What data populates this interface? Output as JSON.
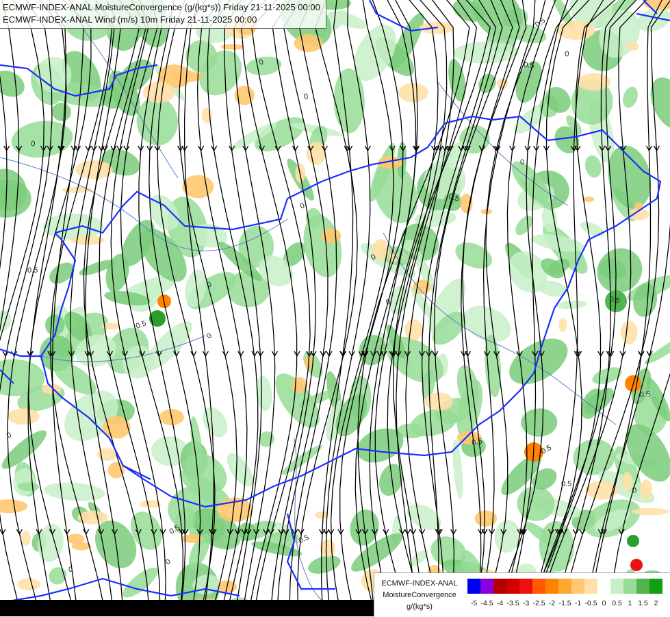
{
  "titles": {
    "line1": "ECMWF-INDEX-ANAL MoistureConvergence (g/(kg*s)) Friday 21-11-2025 00:00",
    "line2": "ECMWF-INDEX-ANAL Wind (m/s) 10m Friday 21-11-2025 00:00"
  },
  "legend": {
    "model": "ECMWF-INDEX-ANAL",
    "field": "MoistureConvergence",
    "unit": "g/(kg*s)",
    "ticks": [
      "-5",
      "-4.5",
      "-4",
      "-3.5",
      "-3",
      "-2.5",
      "-2",
      "-1.5",
      "-1",
      "-0.5",
      "0",
      "0.5",
      "1",
      "1.5",
      "2"
    ],
    "colors": [
      "#0000f0",
      "#8a00e0",
      "#b40000",
      "#d20000",
      "#ee1010",
      "#ff5a00",
      "#ff8200",
      "#ffa830",
      "#ffc870",
      "#ffe0a8",
      "#ffffff",
      "#c8f0c8",
      "#96dc96",
      "#50b450",
      "#10a010"
    ]
  },
  "contour_labels": [
    "0",
    "0.5",
    "-0.5"
  ],
  "colors": {
    "border": "#1a2fff",
    "river": "#5a7fc8",
    "streamline": "#000000",
    "pos_fill": "#96dc96",
    "neg_fill": "#ffc870"
  }
}
